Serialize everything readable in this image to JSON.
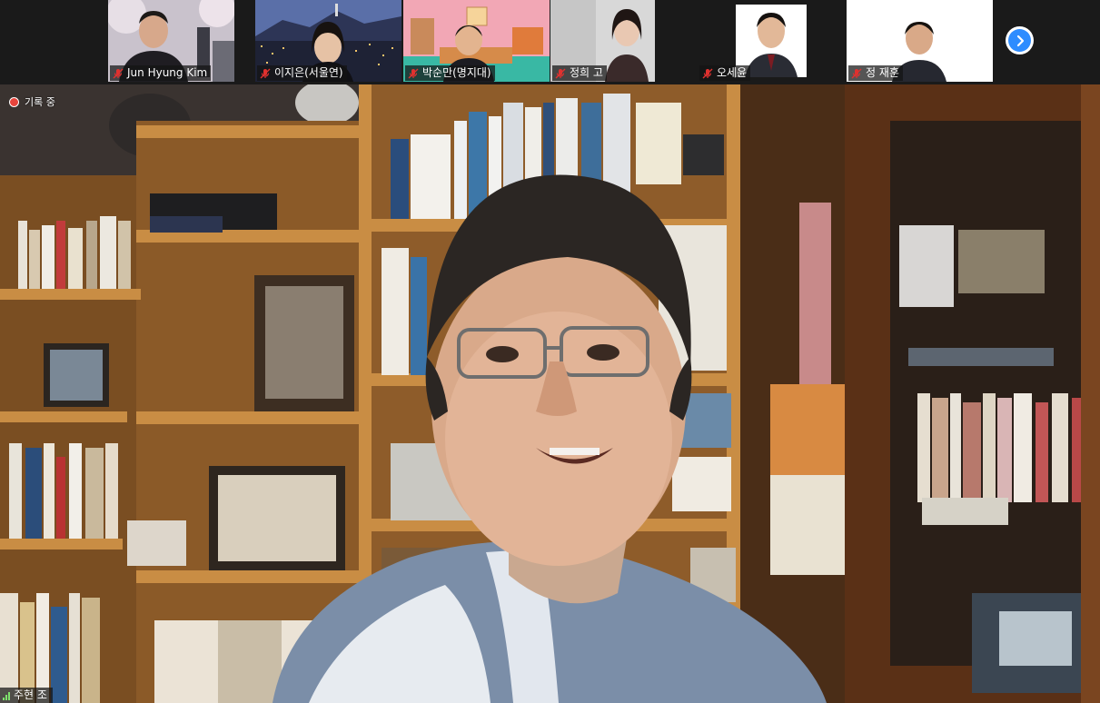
{
  "recording": {
    "label": "기록 중"
  },
  "participants": [
    {
      "name": "Jun Hyung Kim",
      "muted": true
    },
    {
      "name": "이지은(서울연)",
      "muted": true
    },
    {
      "name": "박순만(명지대)",
      "muted": true
    },
    {
      "name": "정희 고",
      "muted": true
    },
    {
      "name": "오세윤",
      "muted": true
    },
    {
      "name": "정 재훈",
      "muted": true
    }
  ],
  "next_page": {
    "icon": "chevron-right-icon"
  },
  "active_speaker": {
    "name": "주현 조",
    "icon": "signal-strength-icon"
  },
  "colors": {
    "accent": "#2d8cff",
    "muted_red": "#e0312f",
    "recording": "#e8453c"
  }
}
